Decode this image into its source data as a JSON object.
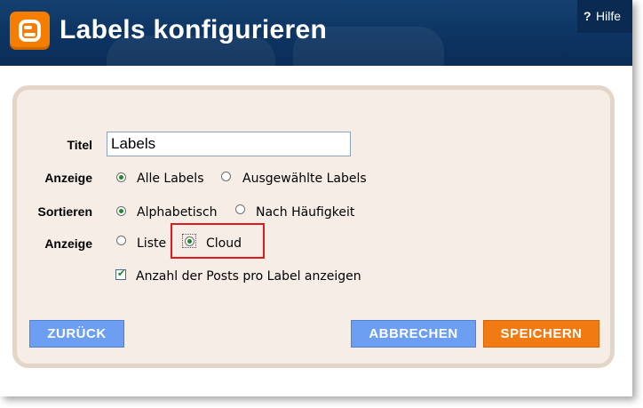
{
  "header": {
    "title": "Labels konfigurieren",
    "help": {
      "icon": "?",
      "label": "Hilfe"
    },
    "logo": "blogger-logo-icon"
  },
  "form": {
    "title_label": "Titel",
    "title_value": "Labels",
    "show_label": "Anzeige",
    "show_options": [
      {
        "label": "Alle Labels",
        "selected": true
      },
      {
        "label": "Ausgewählte Labels",
        "selected": false
      }
    ],
    "sort_label": "Sortieren",
    "sort_options": [
      {
        "label": "Alphabetisch",
        "selected": true
      },
      {
        "label": "Nach Häufigkeit",
        "selected": false
      }
    ],
    "display_label": "Anzeige",
    "display_options": [
      {
        "label": "Liste",
        "selected": false
      },
      {
        "label": "Cloud",
        "selected": true
      }
    ],
    "show_counts": {
      "label": "Anzahl der Posts pro Label anzeigen",
      "checked": true
    }
  },
  "buttons": {
    "back": "ZURÜCK",
    "cancel": "ABBRECHEN",
    "save": "SPEICHERN"
  },
  "colors": {
    "header_bg": "#0d3462",
    "panel_bg": "#f5ede6",
    "blue_button": "#6c9ef2",
    "orange_button": "#f27a12",
    "highlight": "#e11b1b"
  }
}
